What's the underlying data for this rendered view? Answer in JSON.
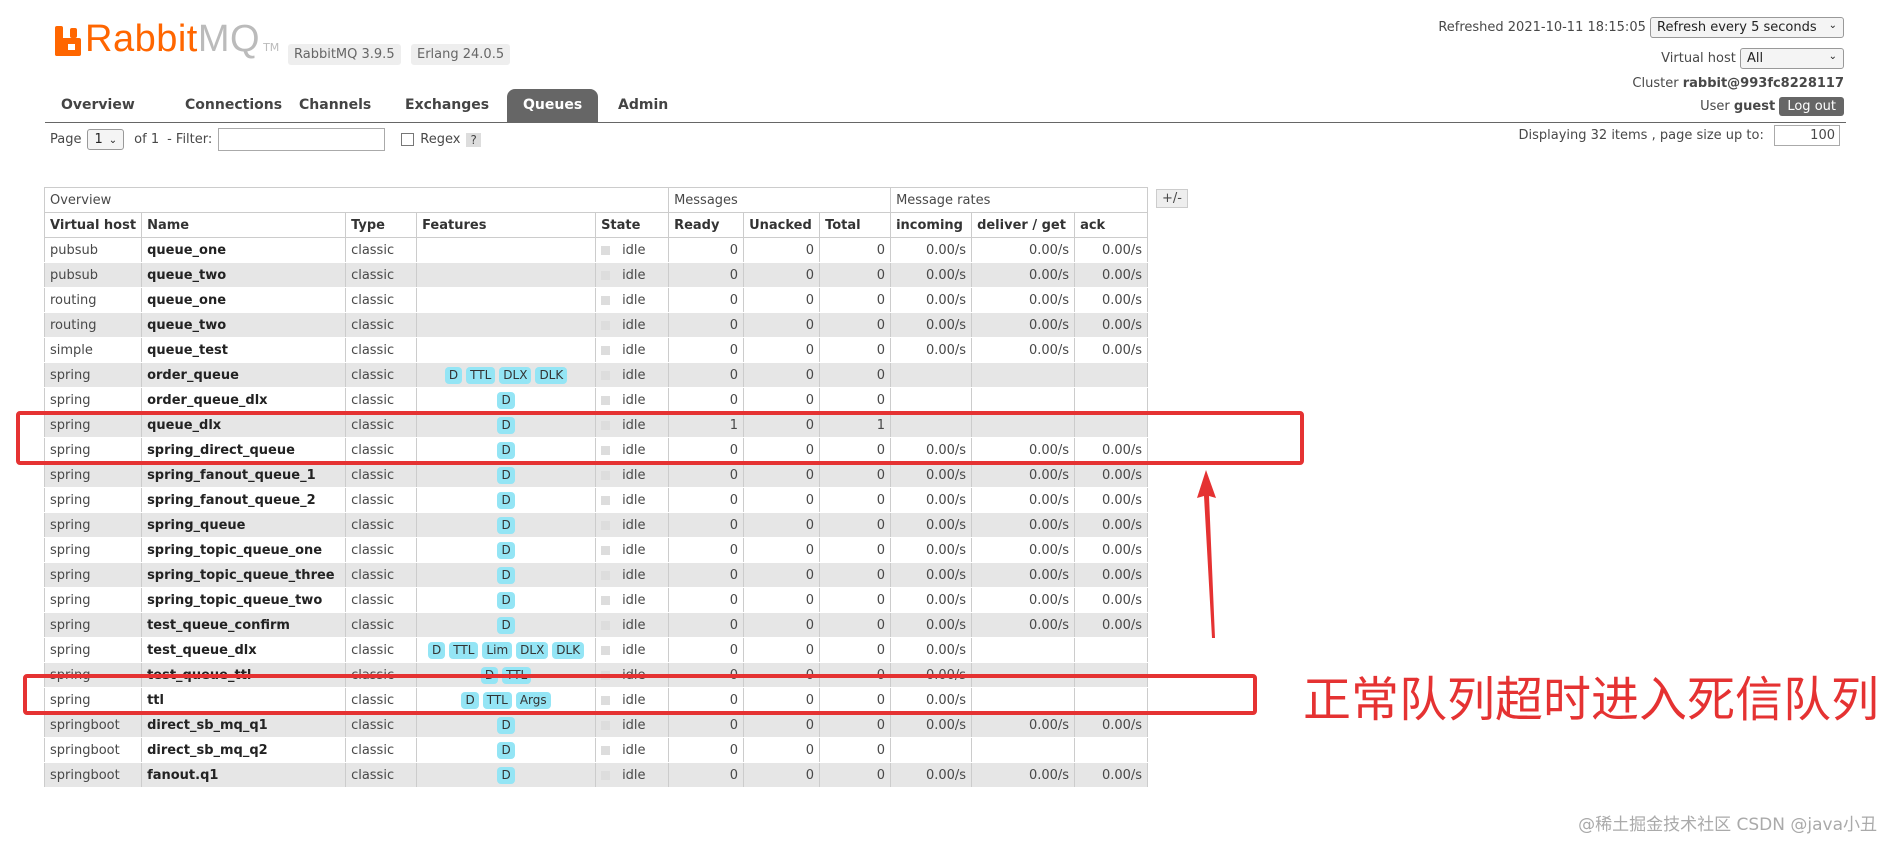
{
  "brand": {
    "name_rabbit": "Rabbit",
    "name_mq": "MQ",
    "tm": "TM"
  },
  "versions": {
    "rabbitmq": "RabbitMQ 3.9.5",
    "erlang": "Erlang 24.0.5"
  },
  "header": {
    "refreshed": "Refreshed 2021-10-11 18:15:05",
    "refresh_option": "Refresh every 5 seconds",
    "vhost_label": "Virtual host",
    "vhost_value": "All",
    "cluster_label": "Cluster",
    "cluster_value": "rabbit@993fc8228117",
    "user_label": "User",
    "user_value": "guest",
    "logout": "Log out"
  },
  "tabs": [
    "Overview",
    "Connections",
    "Channels",
    "Exchanges",
    "Queues",
    "Admin"
  ],
  "active_tab": "Queues",
  "pager": {
    "page_label": "Page",
    "page_value": "1",
    "of": "of 1",
    "filter_label": "- Filter:",
    "regex_label": "Regex",
    "help": "?"
  },
  "display": {
    "text": "Displaying 32 items , page size up to:",
    "size": "100"
  },
  "table": {
    "groups": [
      "Overview",
      "Messages",
      "Message rates"
    ],
    "plusminus": "+/-",
    "columns": [
      "Virtual host",
      "Name",
      "Type",
      "Features",
      "State",
      "Ready",
      "Unacked",
      "Total",
      "incoming",
      "deliver / get",
      "ack"
    ],
    "rows": [
      {
        "vhost": "pubsub",
        "name": "queue_one",
        "type": "classic",
        "features": [],
        "state": "idle",
        "ready": "0",
        "unacked": "0",
        "total": "0",
        "incoming": "0.00/s",
        "deliver": "0.00/s",
        "ack": "0.00/s"
      },
      {
        "vhost": "pubsub",
        "name": "queue_two",
        "type": "classic",
        "features": [],
        "state": "idle",
        "ready": "0",
        "unacked": "0",
        "total": "0",
        "incoming": "0.00/s",
        "deliver": "0.00/s",
        "ack": "0.00/s"
      },
      {
        "vhost": "routing",
        "name": "queue_one",
        "type": "classic",
        "features": [],
        "state": "idle",
        "ready": "0",
        "unacked": "0",
        "total": "0",
        "incoming": "0.00/s",
        "deliver": "0.00/s",
        "ack": "0.00/s"
      },
      {
        "vhost": "routing",
        "name": "queue_two",
        "type": "classic",
        "features": [],
        "state": "idle",
        "ready": "0",
        "unacked": "0",
        "total": "0",
        "incoming": "0.00/s",
        "deliver": "0.00/s",
        "ack": "0.00/s"
      },
      {
        "vhost": "simple",
        "name": "queue_test",
        "type": "classic",
        "features": [],
        "state": "idle",
        "ready": "0",
        "unacked": "0",
        "total": "0",
        "incoming": "0.00/s",
        "deliver": "0.00/s",
        "ack": "0.00/s"
      },
      {
        "vhost": "spring",
        "name": "order_queue",
        "type": "classic",
        "features": [
          "D",
          "TTL",
          "DLX",
          "DLK"
        ],
        "state": "idle",
        "ready": "0",
        "unacked": "0",
        "total": "0",
        "incoming": "",
        "deliver": "",
        "ack": ""
      },
      {
        "vhost": "spring",
        "name": "order_queue_dlx",
        "type": "classic",
        "features": [
          "D"
        ],
        "state": "idle",
        "ready": "0",
        "unacked": "0",
        "total": "0",
        "incoming": "",
        "deliver": "",
        "ack": ""
      },
      {
        "vhost": "spring",
        "name": "queue_dlx",
        "type": "classic",
        "features": [
          "D"
        ],
        "state": "idle",
        "ready": "1",
        "unacked": "0",
        "total": "1",
        "incoming": "",
        "deliver": "",
        "ack": ""
      },
      {
        "vhost": "spring",
        "name": "spring_direct_queue",
        "type": "classic",
        "features": [
          "D"
        ],
        "state": "idle",
        "ready": "0",
        "unacked": "0",
        "total": "0",
        "incoming": "0.00/s",
        "deliver": "0.00/s",
        "ack": "0.00/s"
      },
      {
        "vhost": "spring",
        "name": "spring_fanout_queue_1",
        "type": "classic",
        "features": [
          "D"
        ],
        "state": "idle",
        "ready": "0",
        "unacked": "0",
        "total": "0",
        "incoming": "0.00/s",
        "deliver": "0.00/s",
        "ack": "0.00/s"
      },
      {
        "vhost": "spring",
        "name": "spring_fanout_queue_2",
        "type": "classic",
        "features": [
          "D"
        ],
        "state": "idle",
        "ready": "0",
        "unacked": "0",
        "total": "0",
        "incoming": "0.00/s",
        "deliver": "0.00/s",
        "ack": "0.00/s"
      },
      {
        "vhost": "spring",
        "name": "spring_queue",
        "type": "classic",
        "features": [
          "D"
        ],
        "state": "idle",
        "ready": "0",
        "unacked": "0",
        "total": "0",
        "incoming": "0.00/s",
        "deliver": "0.00/s",
        "ack": "0.00/s"
      },
      {
        "vhost": "spring",
        "name": "spring_topic_queue_one",
        "type": "classic",
        "features": [
          "D"
        ],
        "state": "idle",
        "ready": "0",
        "unacked": "0",
        "total": "0",
        "incoming": "0.00/s",
        "deliver": "0.00/s",
        "ack": "0.00/s"
      },
      {
        "vhost": "spring",
        "name": "spring_topic_queue_three",
        "type": "classic",
        "features": [
          "D"
        ],
        "state": "idle",
        "ready": "0",
        "unacked": "0",
        "total": "0",
        "incoming": "0.00/s",
        "deliver": "0.00/s",
        "ack": "0.00/s"
      },
      {
        "vhost": "spring",
        "name": "spring_topic_queue_two",
        "type": "classic",
        "features": [
          "D"
        ],
        "state": "idle",
        "ready": "0",
        "unacked": "0",
        "total": "0",
        "incoming": "0.00/s",
        "deliver": "0.00/s",
        "ack": "0.00/s"
      },
      {
        "vhost": "spring",
        "name": "test_queue_confirm",
        "type": "classic",
        "features": [
          "D"
        ],
        "state": "idle",
        "ready": "0",
        "unacked": "0",
        "total": "0",
        "incoming": "0.00/s",
        "deliver": "0.00/s",
        "ack": "0.00/s"
      },
      {
        "vhost": "spring",
        "name": "test_queue_dlx",
        "type": "classic",
        "features": [
          "D",
          "TTL",
          "Lim",
          "DLX",
          "DLK"
        ],
        "state": "idle",
        "ready": "0",
        "unacked": "0",
        "total": "0",
        "incoming": "0.00/s",
        "deliver": "",
        "ack": ""
      },
      {
        "vhost": "spring",
        "name": "test_queue_ttl",
        "type": "classic",
        "features": [
          "D",
          "TTL"
        ],
        "state": "idle",
        "ready": "0",
        "unacked": "0",
        "total": "0",
        "incoming": "0.00/s",
        "deliver": "",
        "ack": ""
      },
      {
        "vhost": "spring",
        "name": "ttl",
        "type": "classic",
        "features": [
          "D",
          "TTL",
          "Args"
        ],
        "state": "idle",
        "ready": "0",
        "unacked": "0",
        "total": "0",
        "incoming": "0.00/s",
        "deliver": "",
        "ack": ""
      },
      {
        "vhost": "springboot",
        "name": "direct_sb_mq_q1",
        "type": "classic",
        "features": [
          "D"
        ],
        "state": "idle",
        "ready": "0",
        "unacked": "0",
        "total": "0",
        "incoming": "0.00/s",
        "deliver": "0.00/s",
        "ack": "0.00/s"
      },
      {
        "vhost": "springboot",
        "name": "direct_sb_mq_q2",
        "type": "classic",
        "features": [
          "D"
        ],
        "state": "idle",
        "ready": "0",
        "unacked": "0",
        "total": "0",
        "incoming": "",
        "deliver": "",
        "ack": ""
      },
      {
        "vhost": "springboot",
        "name": "fanout.q1",
        "type": "classic",
        "features": [
          "D"
        ],
        "state": "idle",
        "ready": "0",
        "unacked": "0",
        "total": "0",
        "incoming": "0.00/s",
        "deliver": "0.00/s",
        "ack": "0.00/s"
      }
    ]
  },
  "annotation": {
    "text": "正常队列超时进入死信队列",
    "color": "#e53232"
  },
  "watermark": "@稀土掘金技术社区 CSDN @java小丑",
  "colors": {
    "brand_orange": "#ff6600",
    "tab_active": "#666666",
    "feature_badge": "#94e5f5",
    "highlight": "#e53232"
  }
}
